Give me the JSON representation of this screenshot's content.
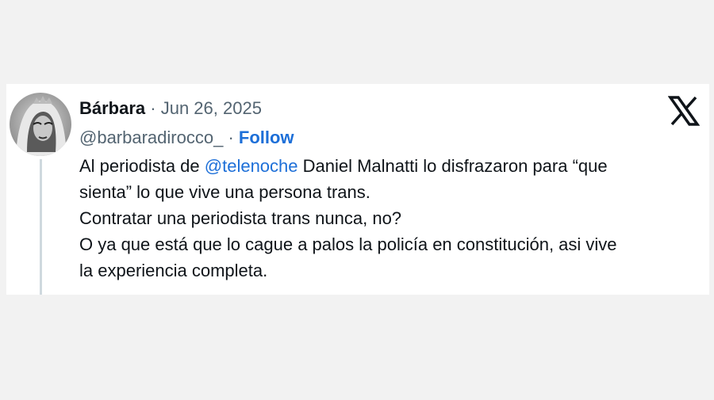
{
  "tweet": {
    "author_name": "Bárbara",
    "separator": " · ",
    "date": "Jun 26, 2025",
    "handle": "@barbaradirocco_",
    "follow_separator": " · ",
    "follow_label": "Follow",
    "text": {
      "line1_before": "Al periodista de ",
      "line1_mention": "@telenoche",
      "line1_after": "  Daniel Malnatti lo disfrazaron para “que",
      "line2": "sienta” lo que vive una persona trans.",
      "line3": "Contratar una periodista trans nunca, no?",
      "line4": "O ya que está que lo cague a palos la policía en constitución, asi vive",
      "line5": "la experiencia completa."
    }
  },
  "icons": {
    "logo": "x-logo-icon",
    "avatar": "profile-avatar"
  },
  "colors": {
    "link": "#1d6fd8",
    "text": "#0f1419",
    "muted": "#536471",
    "thread_line": "#cfd9de"
  }
}
